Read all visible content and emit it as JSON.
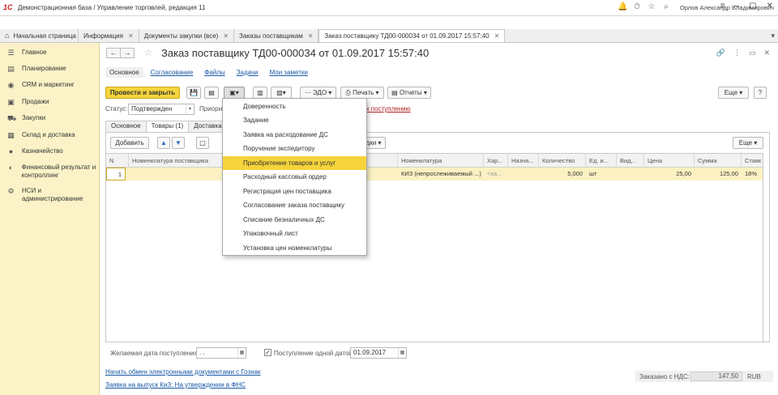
{
  "window": {
    "title": "Демонстрационная база / Управление торговлей, редакция 11",
    "user": "Орлов Александр Владимирович"
  },
  "tabs": [
    {
      "label": "Начальная страница"
    },
    {
      "label": "Информация"
    },
    {
      "label": "Документы закупки (все)"
    },
    {
      "label": "Заказы поставщикам"
    },
    {
      "label": "Заказ поставщику ТД00-000034 от 01.09.2017 15:57:40"
    }
  ],
  "sidebar": {
    "items": [
      {
        "label": "Главное",
        "icon": "menu-icon"
      },
      {
        "label": "Планирование",
        "icon": "planning-icon"
      },
      {
        "label": "CRM и маркетинг",
        "icon": "crm-icon"
      },
      {
        "label": "Продажи",
        "icon": "sales-icon"
      },
      {
        "label": "Закупки",
        "icon": "purchases-icon"
      },
      {
        "label": "Склад и доставка",
        "icon": "warehouse-icon"
      },
      {
        "label": "Казначейство",
        "icon": "treasury-icon"
      },
      {
        "label": "Финансовый результат и контроллинг",
        "icon": "finance-icon"
      },
      {
        "label": "НСИ и администрирование",
        "icon": "settings-icon"
      }
    ]
  },
  "document": {
    "title": "Заказ поставщику ТД00-000034 от 01.09.2017 15:57:40",
    "subnav": [
      "Основное",
      "Согласование",
      "Файлы",
      "Задачи",
      "Мои заметки"
    ]
  },
  "toolbar": {
    "post_close": "Провести и закрыть",
    "edo": "ЭДО",
    "print": "Печать",
    "reports": "Отчеты",
    "more": "Еще",
    "help": "?"
  },
  "status": {
    "label": "Статус:",
    "value": "Подтвержден",
    "priority_label": "Приорит",
    "link": "к поступлению"
  },
  "form_tabs": [
    "Основное",
    "Товары (1)",
    "Доставка"
  ],
  "table_toolbar": {
    "add": "Добавить",
    "fill_partial": "дки",
    "more": "Еще"
  },
  "table": {
    "columns": [
      "N",
      "Номенклатура поставщика",
      "Номенклатура",
      "Хар...",
      "Назна...",
      "Количество",
      "Ед. и...",
      "Вид...",
      "Цена",
      "Сумма",
      "Ставк"
    ],
    "rows": [
      {
        "n": "1",
        "supplier_item": "",
        "item": "КИЗ (непрослеживаемый ...)",
        "char": "<ха...",
        "purpose": "",
        "qty": "5,000",
        "unit": "шт",
        "kind": "",
        "price": "25,00",
        "sum": "125,00",
        "vat": "18%"
      }
    ]
  },
  "menu": {
    "items": [
      "Доверенность",
      "Задание",
      "Заявка на расходование ДС",
      "Поручение экспедитору",
      "Приобретение товаров и услуг",
      "Расходный кассовый ордер",
      "Регистрация цен поставщика",
      "Согласование заказа поставщику",
      "Списание безналичных ДС",
      "Упаковочный лист",
      "Установка цен номенклатуры"
    ],
    "highlighted_index": 4
  },
  "bottom": {
    "desired_date_label": "Желаемая дата поступления:",
    "desired_date_value": " .  .",
    "single_date_label": "Поступление одной датой",
    "single_date_value": "01.09.2017",
    "link1": "Начать обмен электронными документами с Гознак",
    "link2": "Заявка на выпуск КиЗ: На утверждении в ФНС",
    "total_label": "Заказано с НДС:",
    "total_value": "147,50",
    "currency": "RUB"
  }
}
